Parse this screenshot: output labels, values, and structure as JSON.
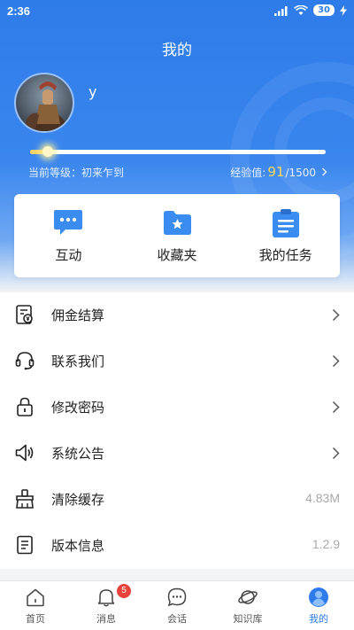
{
  "status_bar": {
    "time": "2:36",
    "battery": "30"
  },
  "header": {
    "title": "我的"
  },
  "profile": {
    "username": "y",
    "level_label": "当前等级：初来乍到",
    "exp_label": "经验值:",
    "exp_value": "91",
    "exp_max": "/1500",
    "progress_fraction": 0.06
  },
  "quick_actions": [
    {
      "label": "互动",
      "icon": "chat-bubble-icon"
    },
    {
      "label": "收藏夹",
      "icon": "folder-star-icon"
    },
    {
      "label": "我的任务",
      "icon": "clipboard-icon"
    }
  ],
  "menu": [
    {
      "label": "佣金结算",
      "icon": "commission-doc-icon",
      "value": "",
      "chevron": true
    },
    {
      "label": "联系我们",
      "icon": "headset-icon",
      "value": "",
      "chevron": true
    },
    {
      "label": "修改密码",
      "icon": "lock-icon",
      "value": "",
      "chevron": true
    },
    {
      "label": "系统公告",
      "icon": "speaker-icon",
      "value": "",
      "chevron": true
    },
    {
      "label": "清除缓存",
      "icon": "broom-icon",
      "value": "4.83M",
      "chevron": false
    },
    {
      "label": "版本信息",
      "icon": "document-icon",
      "value": "1.2.9",
      "chevron": false
    }
  ],
  "tabbar": [
    {
      "label": "首页",
      "icon": "home-icon",
      "active": false
    },
    {
      "label": "消息",
      "icon": "bell-icon",
      "active": false,
      "badge": "5"
    },
    {
      "label": "会话",
      "icon": "chat-icon",
      "active": false
    },
    {
      "label": "知识库",
      "icon": "planet-icon",
      "active": false
    },
    {
      "label": "我的",
      "icon": "user-icon",
      "active": true
    }
  ],
  "colors": {
    "primary": "#2e7bea",
    "badge": "#e8433b",
    "exp_highlight": "#ffd95a"
  }
}
